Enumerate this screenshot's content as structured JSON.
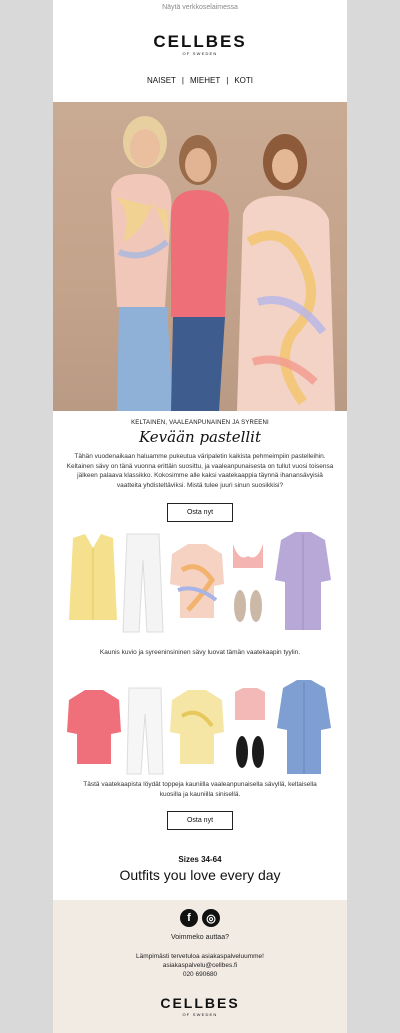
{
  "header": {
    "browser_link": "Näytä verkkoselaimessa",
    "logo_main": "CELLBES",
    "logo_sub": "OF SWEDEN"
  },
  "nav": {
    "items": [
      {
        "label": "NAISET"
      },
      {
        "label": "MIEHET"
      },
      {
        "label": "KOTI"
      }
    ],
    "separator": "|"
  },
  "hero": {
    "eyebrow": "KELTAINEN, VAALEANPUNAINEN JA SYREENI",
    "headline": "Kevään pastellit",
    "body": "Tähän vuodenaikaan haluamme pukeutua väripaletin kaikista pehmeimpiin pastelleihin. Keltainen sävy on tänä vuonna erittäin suosittu, ja vaaleanpunaisesta on tullut vuosi toisensa jälkeen palaava klassikko. Kokosimme alle kaksi vaatekaappia täynnä ihanansävyisiä vaatteita yhdisteltäviksi. Mistä tulee juuri sinun suosikkisi?",
    "cta": "Osta nyt"
  },
  "wardrobe1": {
    "caption": "Kaunis kuvio ja syreeninsininen sävy luovat tämän vaatekaapin tyylin."
  },
  "wardrobe2": {
    "caption": "Tästä vaatekaapista löydät toppeja kauniilla vaaleanpunaisella sävyllä, keltaisella kuosilla ja kauniilla sinisellä.",
    "cta": "Osta nyt"
  },
  "promo": {
    "sizes": "Sizes 34-64",
    "tagline": "Outfits you love every day"
  },
  "footer": {
    "help": "Voimmeko auttaa?",
    "welcome": "Lämpimästi tervetuloa asiakaspalveluumme!",
    "email": "asiakaspalvelu@cellbes.fi",
    "phone": "020 690680",
    "logo_main": "CELLBES",
    "logo_sub": "OF SWEDEN",
    "social": [
      {
        "name": "facebook-icon",
        "glyph": "f"
      },
      {
        "name": "instagram-icon",
        "glyph": "◎"
      }
    ]
  }
}
